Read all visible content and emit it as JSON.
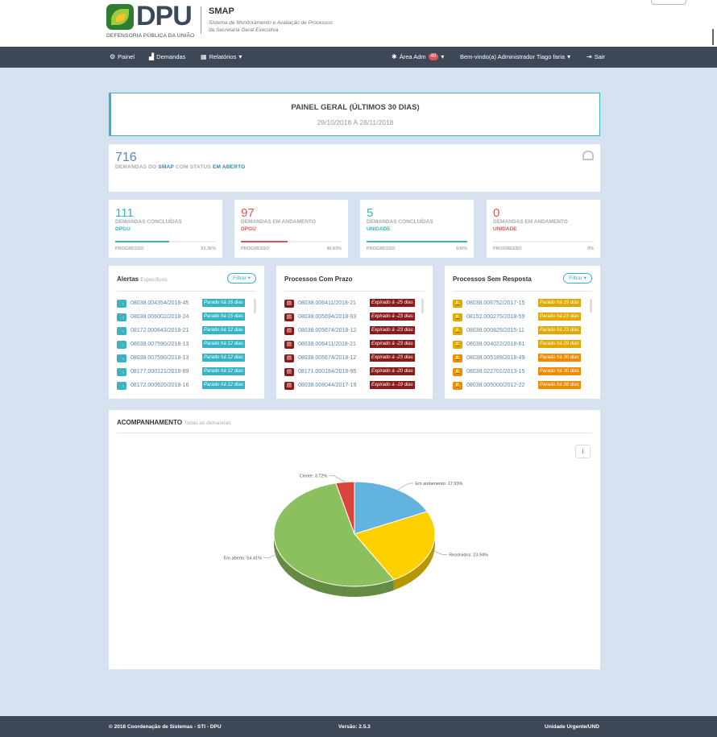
{
  "header": {
    "logo_text": "DPU",
    "logo_sub": "DEFENSORIA PÚBLICA DA UNIÃO",
    "app_name": "SMAP",
    "app_desc": "Sistema de Monitoramento e Avaliação de Processos da Secretaria Geral Executiva"
  },
  "nav": {
    "painel": "Painel",
    "demandas": "Demandas",
    "relatorios": "Relatórios",
    "area_adm": "Área Adm",
    "area_adm_badge": "40",
    "welcome": "Bem-vindo(a) Administrador Tiago faria",
    "logout": "Sair"
  },
  "title_card": {
    "title": "PAINEL GERAL (ÚLTIMOS 30 DIAS)",
    "date_range": "29/10/2018 À 28/11/2018"
  },
  "total": {
    "value": "716",
    "label_pre": "DEMANDAS DO",
    "label_smap": "SMAP",
    "label_mid": "COM STATUS",
    "label_status": "EM ABERTO"
  },
  "stats": [
    {
      "value": "111",
      "label": "DEMANDAS CONCLUÍDAS",
      "sub": "DPGU",
      "progress_label": "PROGRESSO",
      "progress_text": "53.36%",
      "progress": 0.5336,
      "color": "#35b5c4"
    },
    {
      "value": "97",
      "label": "DEMANDAS EM ANDAMENTO",
      "sub": "DPGU",
      "progress_label": "PROGRESSO",
      "progress_text": "46.63%",
      "progress": 0.4663,
      "color": "#e05555"
    },
    {
      "value": "5",
      "label": "DEMANDAS CONCLUÍDAS",
      "sub": "UNIDADE",
      "progress_label": "PROGRESSO",
      "progress_text": "100%",
      "progress": 1.0,
      "color": "#35b5c4"
    },
    {
      "value": "0",
      "label": "DEMANDAS EM ANDAMENTO",
      "sub": "UNIDADE",
      "progress_label": "PROGRESSO",
      "progress_text": "0%",
      "progress": 0.0,
      "color": "#e05555"
    }
  ],
  "alertas": {
    "title": "Alertas",
    "subtitle": "Específicos",
    "filter": "Filtrar",
    "rows": [
      {
        "id": "08038.004354/2018-45",
        "tag": "Parado há 16 dias"
      },
      {
        "id": "08038.006002/2018-24",
        "tag": "Parado há 15 dias"
      },
      {
        "id": "08172.000643/2018-21",
        "tag": "Parado há 12 dias"
      },
      {
        "id": "08038.007590/2018-13",
        "tag": "Parado há 12 dias"
      },
      {
        "id": "08038.007590/2018-13",
        "tag": "Parado há 12 dias"
      },
      {
        "id": "08177.000121/2018-89",
        "tag": "Parado há 12 dias"
      },
      {
        "id": "08172.000620/2018-16",
        "tag": "Parado há 12 dias"
      }
    ]
  },
  "prazo": {
    "title": "Processos Com Prazo",
    "rows": [
      {
        "id": "08038.006411/2018-21",
        "tag": "Expirado à -25 dias"
      },
      {
        "id": "08038.005694/2018-93",
        "tag": "Expirado à -23 dias"
      },
      {
        "id": "08038.005674/2018-12",
        "tag": "Expirado à -23 dias"
      },
      {
        "id": "08038.006411/2018-21",
        "tag": "Expirado à -23 dias"
      },
      {
        "id": "08038.005674/2018-12",
        "tag": "Expirado à -23 dias"
      },
      {
        "id": "08171.000184/2018-95",
        "tag": "Expirado à -20 dias"
      },
      {
        "id": "08038.008044/2017-19",
        "tag": "Expirado à -19 dias"
      }
    ]
  },
  "sem_resposta": {
    "title": "Processos Sem Resposta",
    "filter": "Filtrar",
    "rows": [
      {
        "id": "08038.006752/2017-15",
        "tag": "Parado há 19 dias",
        "color": "#e0a800"
      },
      {
        "id": "08152.000275/2018-59",
        "tag": "Parado há 23 dias",
        "color": "#e0a800"
      },
      {
        "id": "08038.000825/2015-11",
        "tag": "Parado há 23 dias",
        "color": "#e0a800"
      },
      {
        "id": "08038.004022/2018-61",
        "tag": "Parado há 29 dias",
        "color": "#e0a800"
      },
      {
        "id": "08038.005189/2018-49",
        "tag": "Parado há 30 dias",
        "color": "#f08a00"
      },
      {
        "id": "08038.022701/2013-15",
        "tag": "Parado há 30 dias",
        "color": "#f08a00"
      },
      {
        "id": "08038.005000/2012-22",
        "tag": "Parado há 36 dias",
        "color": "#f08a00"
      }
    ]
  },
  "acompanhamento": {
    "title": "ACOMPANHAMENTO",
    "subtitle": "Todas as demandas"
  },
  "chart_data": {
    "type": "pie",
    "title": "",
    "slices": [
      {
        "label": "Em andamento",
        "value": 17.93,
        "text": "Em andamento: 17.93%",
        "color": "#63b3df"
      },
      {
        "label": "Resolvidos",
        "value": 23.94,
        "text": "Resolvidos: 23.94%",
        "color": "#ffd000"
      },
      {
        "label": "Em aberto",
        "value": 54.41,
        "text": "Em aberto: 54.41%",
        "color": "#8cbf5e"
      },
      {
        "label": "Ciente",
        "value": 3.72,
        "text": "Ciente: 3.72%",
        "color": "#d9453d"
      }
    ]
  },
  "footer": {
    "copyright": "© 2018 Coordenação de Sistemas - STI - DPU",
    "version": "Versão: 2.5.3",
    "unit": "Unidade Urgente/UND"
  },
  "colors": {
    "nav_bg": "#3d4756",
    "accent": "#35b5c4",
    "danger": "#e05555",
    "expired": "#8b1a1a"
  }
}
